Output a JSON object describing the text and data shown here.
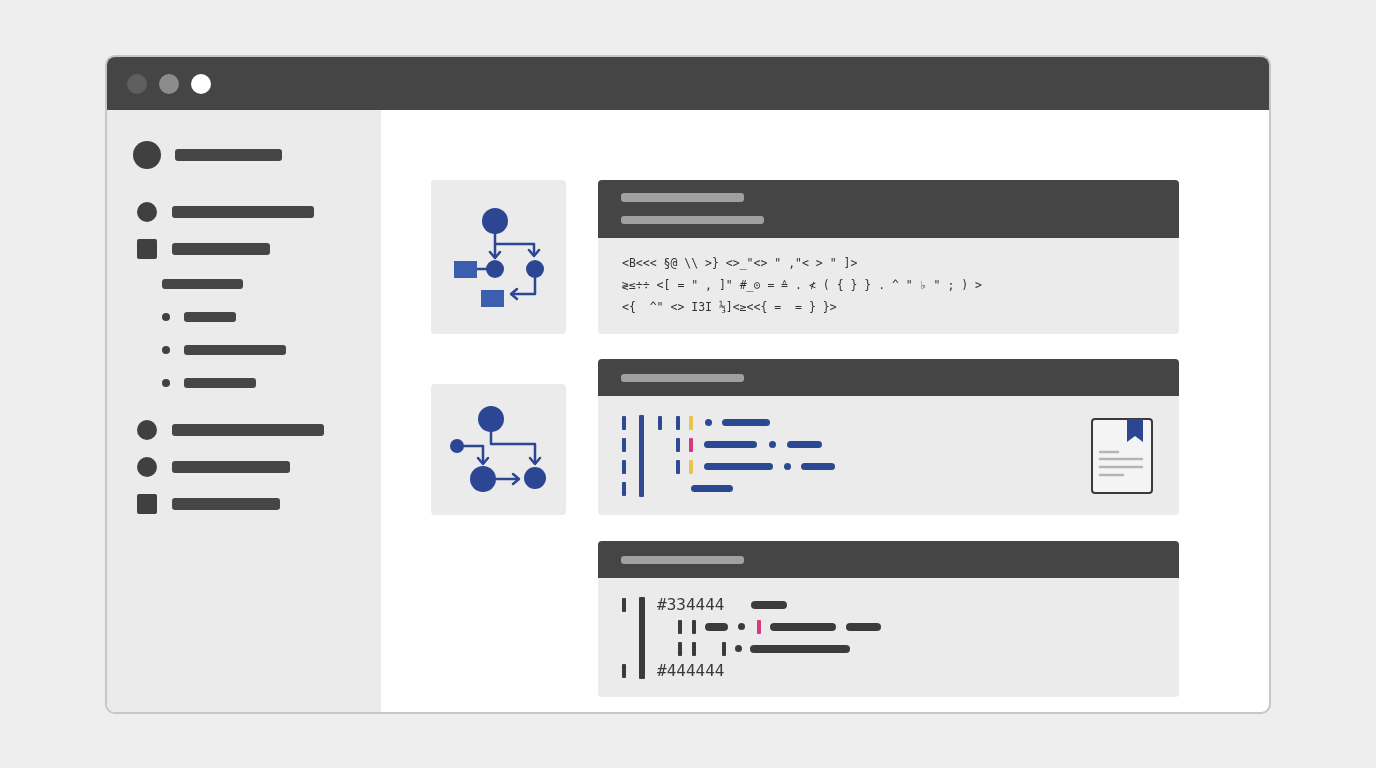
{
  "window": {
    "controls": [
      {
        "color": "#5f5f5f"
      },
      {
        "color": "#8c8c8c"
      },
      {
        "color": "#ffffff"
      }
    ]
  },
  "sidebar": {
    "profile": {
      "kind": "avatar"
    },
    "items": [
      {
        "kind": "circle"
      },
      {
        "kind": "square",
        "children": [
          {
            "kind": "heading"
          },
          {
            "kind": "bullet"
          },
          {
            "kind": "bullet"
          },
          {
            "kind": "bullet"
          }
        ]
      },
      {
        "kind": "circle"
      },
      {
        "kind": "circle"
      },
      {
        "kind": "square"
      }
    ]
  },
  "main": {
    "rows": [
      {
        "diagram": {
          "kind": "boxes"
        },
        "card": {
          "kind": "text",
          "lines": [
            "<B<<< §@ \\\\ >} <>_\"<> \" ,\"< > \" ]>",
            "≷≤÷÷ <[ = \" , ]\" #_⊙ = ≙ . ≮ ( { } } . ^ \" ♭ \" ; ) >",
            "<{  ^\" <> I3I ⅓]<≥<<{ =  = } }>"
          ]
        }
      },
      {
        "diagram": {
          "kind": "circles"
        },
        "card": {
          "kind": "tokens",
          "markers": [
            {
              "color": "#e9c44c"
            },
            {
              "color": "#d8387c"
            },
            {
              "color": "#e9c44c"
            }
          ],
          "attachment": {
            "kind": "document"
          }
        }
      },
      {
        "card": {
          "kind": "mixed",
          "lines": [
            "#334444",
            "#444444"
          ],
          "markers": [
            {
              "color": "#d8387c"
            }
          ]
        }
      }
    ]
  }
}
